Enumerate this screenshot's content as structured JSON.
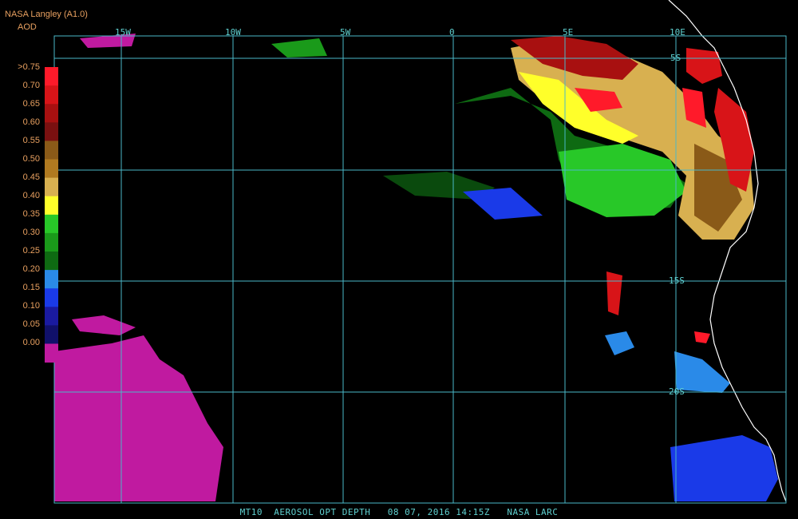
{
  "header": {
    "source": "NASA Langley (A1.0)",
    "product_code": "AOD"
  },
  "legend": {
    "ticks": [
      ">0.75",
      "0.70",
      "0.65",
      "0.60",
      "0.55",
      "0.50",
      "0.45",
      "0.40",
      "0.35",
      "0.30",
      "0.25",
      "0.20",
      "0.15",
      "0.10",
      "0.05",
      "0.00"
    ],
    "colors": [
      "#ff1a2a",
      "#d81418",
      "#a81010",
      "#7a1010",
      "#8a5a18",
      "#b07a20",
      "#d8b050",
      "#ffff2a",
      "#28c828",
      "#1a9a1a",
      "#0e6a12",
      "#2a8ae8",
      "#1a3ae8",
      "#1a1aa0",
      "#10106a",
      "#c01aa0"
    ]
  },
  "grid": {
    "lon_labels": [
      "15W",
      "10W",
      "5W",
      "0",
      "5E",
      "10E"
    ],
    "lat_labels": [
      "5S",
      "15S",
      "20S"
    ]
  },
  "footer": {
    "text": "MT10  AEROSOL OPT DEPTH   08 07, 2016 14:15Z   NASA LARC"
  },
  "colors": {
    "grid_line": "#4ab8c8",
    "coastline": "#ffffff",
    "labels": "#e8a060",
    "background": "#000000"
  }
}
